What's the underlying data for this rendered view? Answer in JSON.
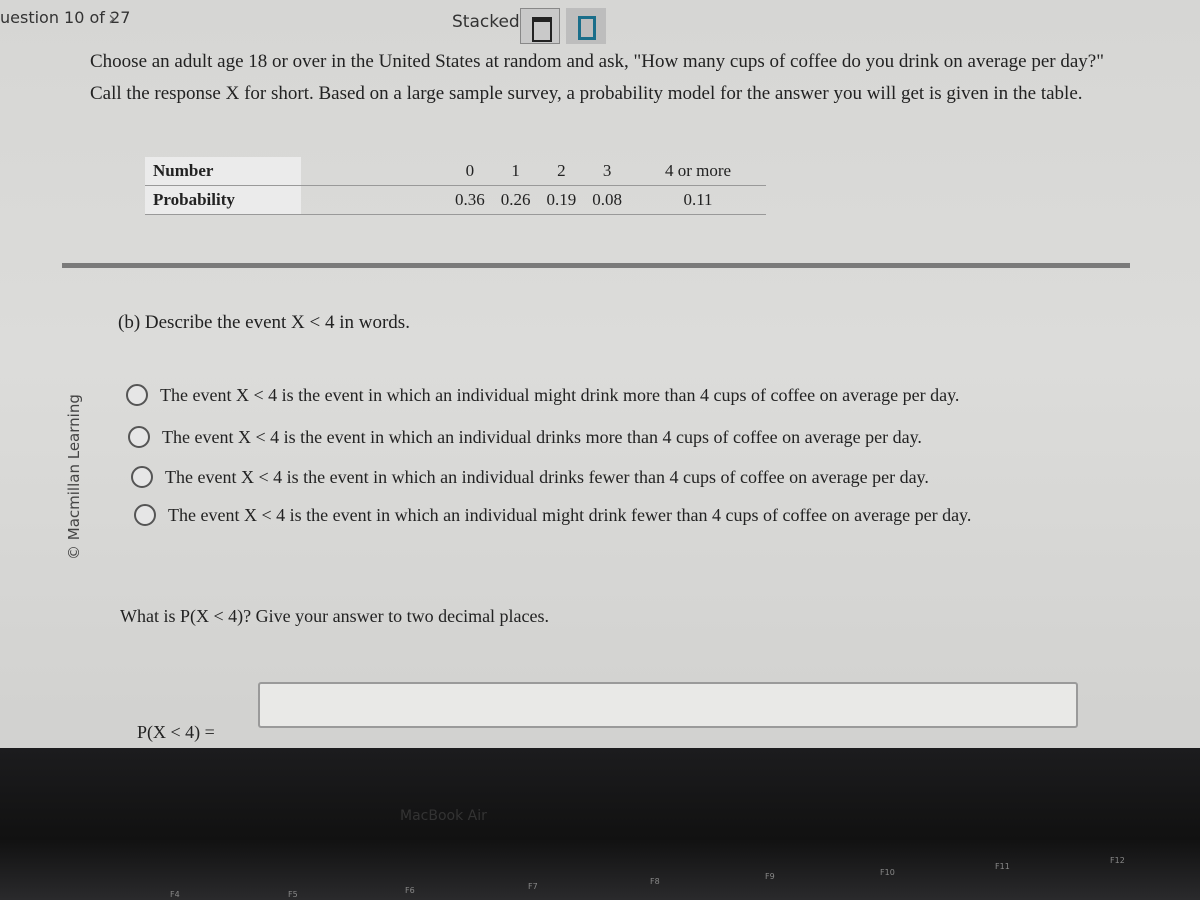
{
  "topbar": {
    "question_counter": "uestion 10 of 27",
    "next_icon": "chevron-right-icon",
    "layout_label": "Stacked",
    "layout_stacked_icon": "stacked-layout-icon",
    "layout_side_icon": "side-by-side-layout-icon"
  },
  "question": {
    "intro": "Choose an adult age 18 or over in the United States at random and ask, \"How many cups of coffee do you drink on average per day?\" Call the response X for short. Based on a large sample survey, a probability model for the answer you will get is given in the table.",
    "table": {
      "row_headers": [
        "Number",
        "Probability"
      ],
      "numbers": [
        "0",
        "1",
        "2",
        "3",
        "4 or more"
      ],
      "probabilities": [
        "0.36",
        "0.26",
        "0.19",
        "0.08",
        "0.11"
      ]
    }
  },
  "copyright": "© Macmillan Learning",
  "part_b": {
    "prompt": "(b) Describe the event X < 4 in words.",
    "options": [
      "The event X < 4 is the event in which an individual might drink more than 4 cups of coffee on average per day.",
      "The event X < 4 is the event in which an individual drinks more than 4 cups of coffee on average per day.",
      "The event X < 4 is the event in which an individual drinks fewer than 4 cups of coffee on average per day.",
      "The event X < 4 is the event in which an individual might drink fewer than 4 cups of coffee on average per day."
    ],
    "probability_question": "What is P(X < 4)? Give your answer to two decimal places.",
    "answer_label": "P(X < 4) =",
    "answer_value": ""
  },
  "laptop": {
    "brand": "MacBook Air",
    "keys": [
      "F4",
      "F5",
      "F6",
      "F7",
      "F8",
      "F9",
      "F10",
      "F11",
      "F12"
    ]
  },
  "colors": {
    "accent": "#1a6e8a",
    "divider": "#7a7a7a"
  }
}
